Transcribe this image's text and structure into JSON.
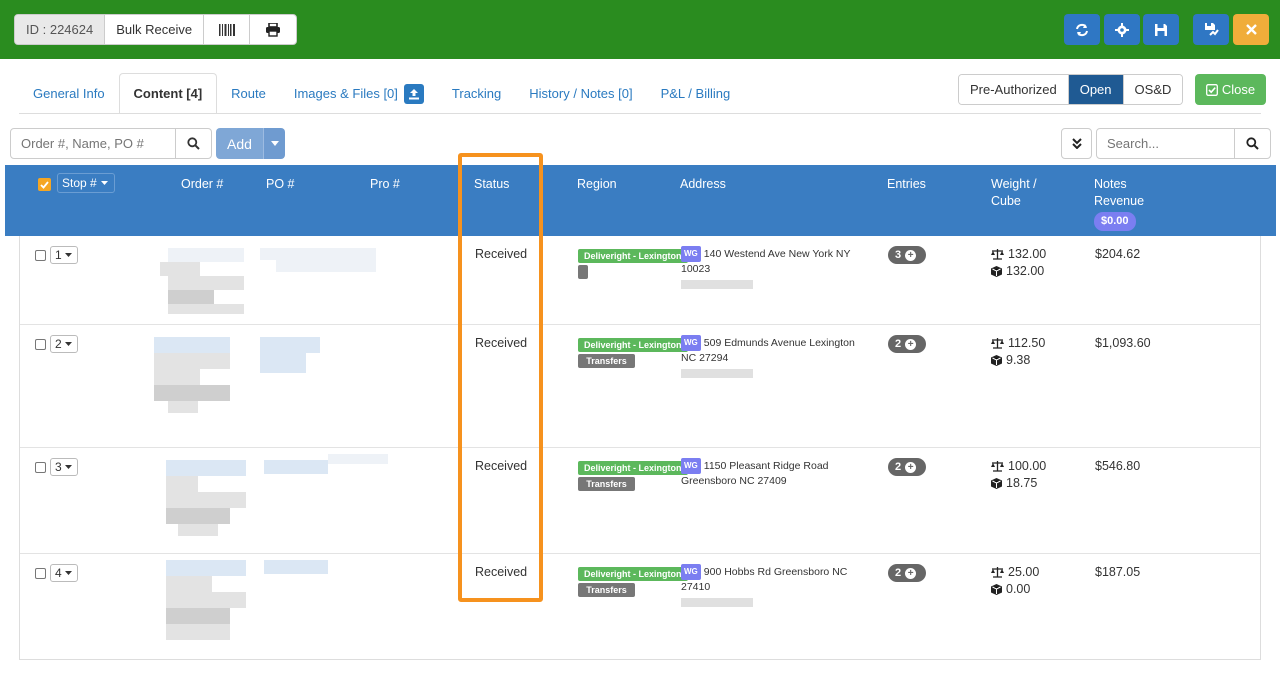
{
  "header": {
    "id_label": "ID : 224624",
    "bulk_receive_label": "Bulk Receive",
    "icons": [
      "barcode-icon",
      "print-icon",
      "refresh-icon",
      "gear-icon",
      "save-icon",
      "save-flag-icon",
      "close-icon"
    ],
    "colors": {
      "bar": "#2a8c1f",
      "blue_button": "#2f77c4",
      "orange_button": "#f0ad3a"
    }
  },
  "tabs": [
    {
      "label": "General Info",
      "active": false
    },
    {
      "label": "Content [4]",
      "active": true
    },
    {
      "label": "Route",
      "active": false
    },
    {
      "label": "Images & Files [0]",
      "active": false
    },
    {
      "label": "Tracking",
      "active": false
    },
    {
      "label": "History / Notes [0]",
      "active": false
    },
    {
      "label": "P&L / Billing",
      "active": false
    }
  ],
  "status_toggle": {
    "options": [
      "Pre-Authorized",
      "Open",
      "OS&D"
    ],
    "selected": "Open"
  },
  "close_button": {
    "label": "Close"
  },
  "toolbar": {
    "filter_placeholder": "Order #, Name, PO #",
    "add_label": "Add",
    "search_placeholder": "Search..."
  },
  "table": {
    "headers": {
      "stop": "Stop #",
      "order": "Order #",
      "po": "PO #",
      "pro": "Pro #",
      "status": "Status",
      "region": "Region",
      "address": "Address",
      "entries": "Entries",
      "weight_line1": "Weight /",
      "weight_line2": "Cube",
      "notes_line1": "Notes",
      "notes_line2": "Revenue",
      "revenue_total": "$0.00"
    },
    "rows": [
      {
        "stop": "1",
        "status": "Received",
        "region": "Deliveright - Lexington",
        "tag": "",
        "wg": "WG",
        "address": "140 Westend Ave New York NY 10023",
        "entries": "3",
        "weight": "132.00",
        "cube": "132.00",
        "revenue": "$204.62"
      },
      {
        "stop": "2",
        "status": "Received",
        "region": "Deliveright - Lexington",
        "tag": "Transfers",
        "wg": "WG",
        "address": "509 Edmunds Avenue Lexington NC 27294",
        "entries": "2",
        "weight": "112.50",
        "cube": "9.38",
        "revenue": "$1,093.60"
      },
      {
        "stop": "3",
        "status": "Received",
        "region": "Deliveright - Lexington",
        "tag": "Transfers",
        "wg": "WG",
        "address": "1150 Pleasant Ridge Road Greensboro NC 27409",
        "entries": "2",
        "weight": "100.00",
        "cube": "18.75",
        "revenue": "$546.80"
      },
      {
        "stop": "4",
        "status": "Received",
        "region": "Deliveright - Lexington",
        "tag": "Transfers",
        "wg": "WG",
        "address": "900 Hobbs Rd Greensboro NC 27410",
        "entries": "2",
        "weight": "25.00",
        "cube": "0.00",
        "revenue": "$187.05"
      }
    ]
  },
  "highlight_color": "#f6921e"
}
